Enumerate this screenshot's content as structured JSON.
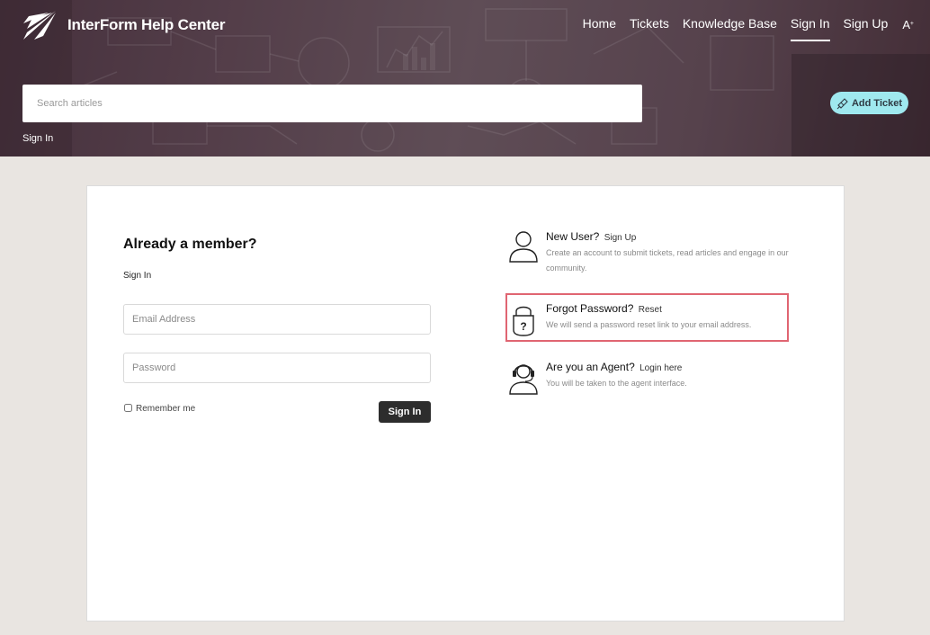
{
  "header": {
    "brand_name": "InterForm Help Center",
    "nav": {
      "home": "Home",
      "tickets": "Tickets",
      "knowledge_base": "Knowledge Base",
      "sign_in": "Sign In",
      "sign_up": "Sign Up",
      "font_toggle": "A"
    },
    "search": {
      "placeholder": "Search articles"
    },
    "add_ticket_label": "Add Ticket",
    "breadcrumb": "Sign In"
  },
  "login": {
    "title": "Already a member?",
    "subtitle": "Sign In",
    "email_placeholder": "Email Address",
    "password_placeholder": "Password",
    "remember_label": "Remember me",
    "submit_label": "Sign In"
  },
  "options": {
    "new_user": {
      "heading": "New User?",
      "link": "Sign Up",
      "description": "Create an account to submit tickets, read articles and engage in our community."
    },
    "forgot": {
      "heading": "Forgot Password?",
      "link": "Reset",
      "description": "We will send a password reset link to your email address."
    },
    "agent": {
      "heading": "Are you an Agent?",
      "link": "Login here",
      "description": "You will be taken to the agent interface."
    }
  },
  "colors": {
    "accent_button": "#9fe9ef",
    "dark_button": "#2d2d2d",
    "highlight_border": "#e06572",
    "page_background": "#e9e5e1"
  },
  "icons": {
    "brand": "paper-plane-logo-icon",
    "add_ticket": "ticket-icon",
    "new_user": "user-outline-icon",
    "forgot": "padlock-question-icon",
    "agent": "headset-agent-icon"
  }
}
